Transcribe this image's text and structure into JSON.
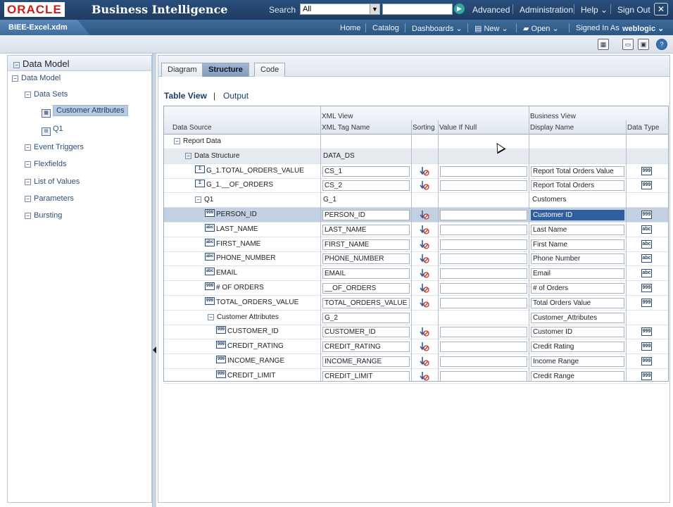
{
  "header": {
    "logo": "ORACLE",
    "product": "Business Intelligence",
    "search_label": "Search",
    "search_scope": "All",
    "links": [
      "Advanced",
      "Administration",
      "Help ⌄",
      "Sign Out"
    ]
  },
  "navbar": {
    "document_tab": "BIEE-Excel.xdm",
    "links": [
      "Home",
      "Catalog",
      "Dashboards ⌄",
      "New ⌄",
      "Open ⌄"
    ],
    "signed_in_label": "Signed In As",
    "user": "weblogic ⌄"
  },
  "left_panel": {
    "title": "Data Model",
    "items": [
      {
        "label": "Data Model"
      },
      {
        "label": "Data Sets"
      },
      {
        "label": "Customer Attributes"
      },
      {
        "label": "Q1"
      },
      {
        "label": "Event Triggers"
      },
      {
        "label": "Flexfields"
      },
      {
        "label": "List of Values"
      },
      {
        "label": "Parameters"
      },
      {
        "label": "Bursting"
      }
    ]
  },
  "tabs": [
    "Diagram",
    "Structure",
    "Code"
  ],
  "views": {
    "table": "Table View",
    "output": "Output"
  },
  "grid_headers": {
    "data_source": "Data Source",
    "xml_view": "XML View",
    "xml_tag": "XML Tag Name",
    "sorting": "Sorting",
    "value_if_null": "Value If Null",
    "business_view": "Business View",
    "display_name": "Display Name",
    "data_type": "Data Type"
  },
  "rows": [
    {
      "source": "Report Data",
      "tag": "",
      "display": ""
    },
    {
      "source": "Data Structure",
      "tag": "DATA_DS",
      "display": ""
    },
    {
      "source": "G_1.TOTAL_ORDERS_VALUE",
      "tag": "CS_1",
      "display": "Report Total Orders Value"
    },
    {
      "source": "G_1.__OF_ORDERS",
      "tag": "CS_2",
      "display": "Report Total Orders"
    },
    {
      "source": "Q1",
      "tag": "G_1",
      "display": "Customers"
    },
    {
      "source": "PERSON_ID",
      "tag": "PERSON_ID",
      "display": "Customer ID"
    },
    {
      "source": "LAST_NAME",
      "tag": "LAST_NAME",
      "display": "Last Name"
    },
    {
      "source": "FIRST_NAME",
      "tag": "FIRST_NAME",
      "display": "First Name"
    },
    {
      "source": "PHONE_NUMBER",
      "tag": "PHONE_NUMBER",
      "display": "Phone Number"
    },
    {
      "source": "EMAIL",
      "tag": "EMAIL",
      "display": "Email"
    },
    {
      "source": "# OF ORDERS",
      "tag": "__OF_ORDERS",
      "display": "# of Orders"
    },
    {
      "source": "TOTAL_ORDERS_VALUE",
      "tag": "TOTAL_ORDERS_VALUE",
      "display": "Total Orders Value"
    },
    {
      "source": "Customer Attributes",
      "tag": "G_2",
      "display": "Customer_Attributes"
    },
    {
      "source": "CUSTOMER_ID",
      "tag": "CUSTOMER_ID",
      "display": "Customer ID"
    },
    {
      "source": "CREDIT_RATING",
      "tag": "CREDIT_RATING",
      "display": "Credit Rating"
    },
    {
      "source": "INCOME_RANGE",
      "tag": "INCOME_RANGE",
      "display": "Income Range"
    },
    {
      "source": "CREDIT_LIMIT",
      "tag": "CREDIT_LIMIT",
      "display": "Credit Range"
    }
  ],
  "icons": {
    "number": "999",
    "string": "abc",
    "sort": "sort-icon",
    "sum": "Σ"
  },
  "colors": {
    "brand_red": "#d11b1b",
    "header_blue": "#1d3c63",
    "selection": "#c2d0e2"
  }
}
